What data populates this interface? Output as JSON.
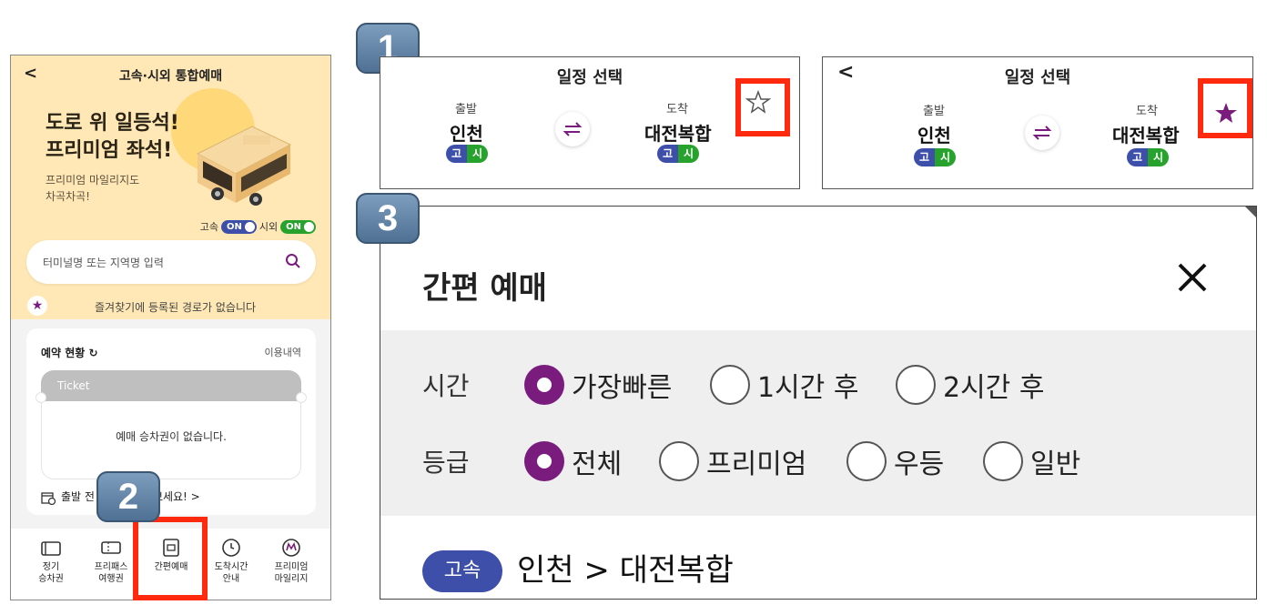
{
  "panel2": {
    "title": "고속·시외 통합예매",
    "promo_line1": "도로 위 일등석!",
    "promo_line2": "프리미엄 좌석!",
    "promo_sub1": "프리미엄 마일리지도",
    "promo_sub2": "차곡차곡!",
    "toggle_express_label": "고속",
    "toggle_express_state": "ON",
    "toggle_intercity_label": "시외",
    "toggle_intercity_state": "ON",
    "search_placeholder": "터미널명 또는 지역명 입력",
    "favorites_empty": "즐겨찾기에 등록된 경로가 없습니다",
    "reservation_title": "예약 현황",
    "reservation_history_link": "이용내역",
    "ticket_label": "Ticket",
    "ticket_empty": "예매 승차권이 없습니다.",
    "departure_prompt_start": "출발 전",
    "departure_prompt_end": "보세요! >",
    "nav": [
      {
        "line1": "정기",
        "line2": "승차권"
      },
      {
        "line1": "프리패스",
        "line2": "여행권"
      },
      {
        "line1": "간편예매",
        "line2": ""
      },
      {
        "line1": "도착시간",
        "line2": "안내"
      },
      {
        "line1": "프리미엄",
        "line2": "마일리지"
      }
    ]
  },
  "badges": {
    "one": "1",
    "two": "2",
    "three": "3"
  },
  "schedule": {
    "title": "일정 선택",
    "depart_label": "출발",
    "depart_city": "인천",
    "arrive_label": "도착",
    "arrive_city": "대전복합",
    "grade_express": "고",
    "grade_intercity": "시"
  },
  "quick": {
    "title": "간편 예매",
    "time_label": "시간",
    "time_options": [
      "가장빠른",
      "1시간 후",
      "2시간 후"
    ],
    "time_selected": "가장빠른",
    "grade_label": "등급",
    "grade_options": [
      "전체",
      "프리미엄",
      "우등",
      "일반"
    ],
    "grade_selected": "전체",
    "route_badge": "고속",
    "route_text": "인천 > 대전복합"
  },
  "colors": {
    "accent_purple": "#7a1c7e",
    "express_blue": "#3d4fa8",
    "intercity_green": "#27a22d",
    "highlight_red": "#ff2a0d",
    "promo_bg": "#ffe8b5"
  }
}
